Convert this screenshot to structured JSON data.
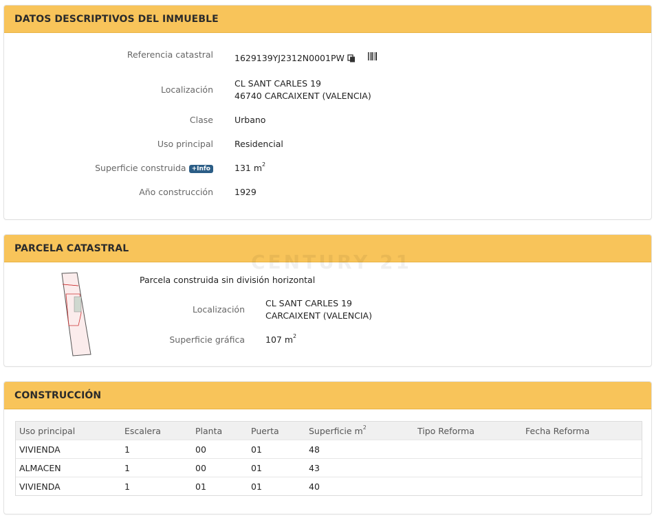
{
  "section1": {
    "title": "DATOS DESCRIPTIVOS DEL INMUEBLE",
    "ref_label": "Referencia catastral",
    "ref_value": "1629139YJ2312N0001PW",
    "loc_label": "Localización",
    "loc_line1": "CL SANT CARLES 19",
    "loc_line2": "46740 CARCAIXENT (VALENCIA)",
    "clase_label": "Clase",
    "clase_value": "Urbano",
    "uso_label": "Uso principal",
    "uso_value": "Residencial",
    "sup_label": "Superficie construida",
    "info_badge": "+Info",
    "sup_value": "131 m",
    "sup_unit_exp": "2",
    "anio_label": "Año construcción",
    "anio_value": "1929"
  },
  "section2": {
    "title": "PARCELA CATASTRAL",
    "subtitle": "Parcela construida sin división horizontal",
    "loc_label": "Localización",
    "loc_line1": "CL SANT CARLES 19",
    "loc_line2": "CARCAIXENT (VALENCIA)",
    "sup_label": "Superficie gráfica",
    "sup_value": "107 m",
    "sup_unit_exp": "2"
  },
  "watermark": "CENTURY 21",
  "section3": {
    "title": "CONSTRUCCIÓN",
    "columns": [
      "Uso principal",
      "Escalera",
      "Planta",
      "Puerta",
      "Superficie m",
      "Tipo Reforma",
      "Fecha Reforma"
    ],
    "sup_col_exp": "2",
    "rows": [
      [
        "VIVIENDA",
        "1",
        "00",
        "01",
        "48",
        "",
        ""
      ],
      [
        "ALMACEN",
        "1",
        "00",
        "01",
        "43",
        "",
        ""
      ],
      [
        "VIVIENDA",
        "1",
        "01",
        "01",
        "40",
        "",
        ""
      ]
    ]
  },
  "icons": [
    "copy-icon",
    "barcode-icon"
  ],
  "colors": {
    "header_bg": "#f8c45a",
    "info_badge": "#2b5d86"
  }
}
